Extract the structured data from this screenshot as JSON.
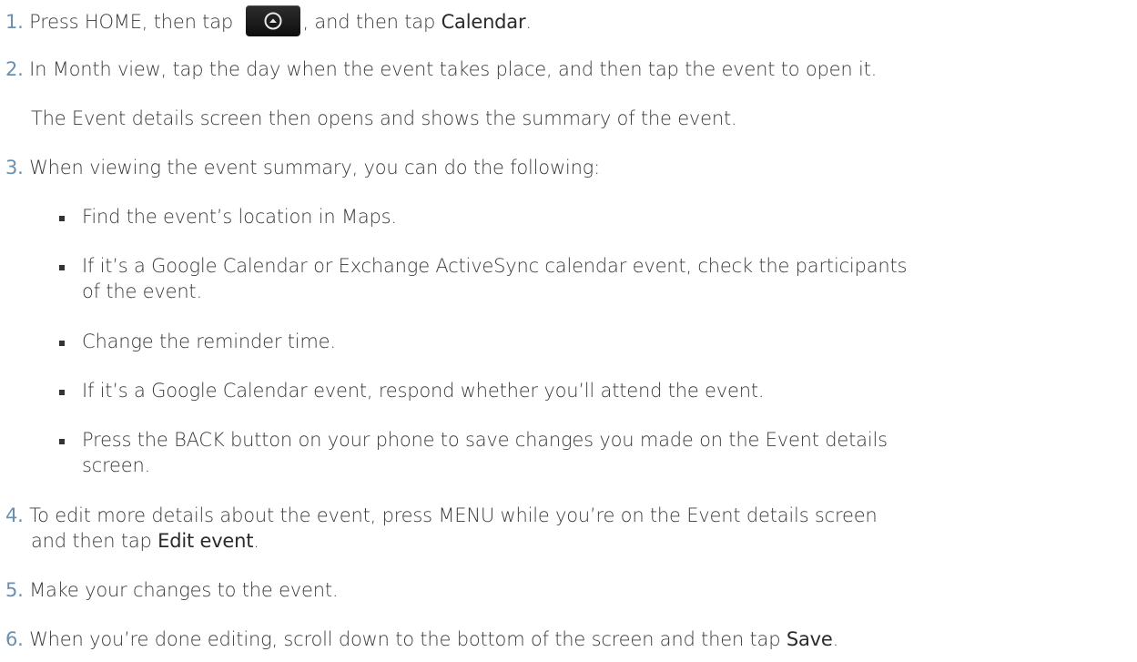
{
  "steps": [
    {
      "num": "1.",
      "before": " Press HOME, then tap ",
      "icon": "all-apps-icon",
      "middle": ", and then tap ",
      "ui": "Calendar",
      "after": "."
    },
    {
      "num": "2.",
      "text": " In Month view, tap the day when the event takes place, and then tap the event to open it.",
      "note": "The Event details screen then opens and shows the summary of the event."
    },
    {
      "num": "3.",
      "text": " When viewing the event summary, you can do the following:",
      "bullets": [
        {
          "lines": [
            "Find the event’s location in Maps."
          ]
        },
        {
          "lines": [
            "If it’s a Google Calendar or Exchange ActiveSync calendar event, check the participants",
            "of the event."
          ]
        },
        {
          "lines": [
            "Change the reminder time."
          ]
        },
        {
          "lines": [
            "If it’s a Google Calendar event, respond whether you’ll attend the event."
          ]
        },
        {
          "lines": [
            "Press the BACK button on your phone to save changes you made on the Event details",
            "screen."
          ]
        }
      ]
    },
    {
      "num": "4.",
      "line1": " To edit more details about the event, press MENU while you’re on the Event details screen",
      "line2_before": "and then tap ",
      "line2_ui": "Edit event",
      "line2_after": "."
    },
    {
      "num": "5.",
      "text": " Make your changes to the event."
    },
    {
      "num": "6.",
      "before": " When you’re done editing, scroll down to the bottom of the screen and then tap ",
      "ui": "Save",
      "after": "."
    }
  ],
  "colors": {
    "number": "#6b8fae",
    "text": "#3a3a3a",
    "ui_term": "#2a2a2a"
  }
}
